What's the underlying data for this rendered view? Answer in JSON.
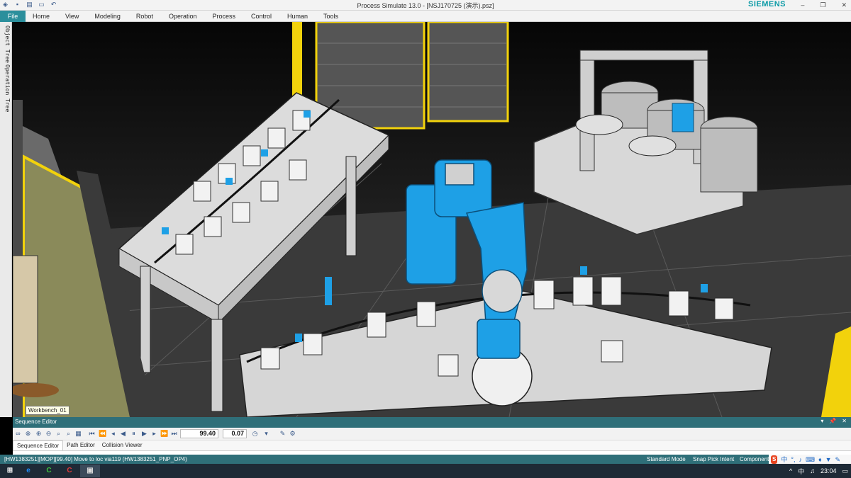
{
  "window": {
    "title": "Process Simulate 13.0 - [NSJ170725 (演示).psz]",
    "brand": "SIEMENS",
    "minimize_glyph": "–",
    "restore_glyph": "❐",
    "close_glyph": "✕"
  },
  "quick_access": {
    "icons": [
      "logo-icon",
      "save-icon",
      "open-icon",
      "new-icon",
      "undo-icon"
    ],
    "undo_glyph": "↶"
  },
  "menu": {
    "file": "File",
    "items": [
      "Home",
      "View",
      "Modeling",
      "Robot",
      "Operation",
      "Process",
      "Control",
      "Human",
      "Tools"
    ]
  },
  "left_dock": {
    "tabs": [
      "Object Tree",
      "Operation Tree"
    ]
  },
  "viewport": {
    "tooltip": "Workbench_01",
    "colors": {
      "robot": "#1ea0e6",
      "fence": "#f2d20c",
      "table": "#dcdcdc",
      "floor": "#3c3c3c"
    }
  },
  "sequence_editor": {
    "title": "Sequence Editor",
    "collapse_glyph": "▾",
    "pin_glyph": "📌",
    "close_glyph": "✕",
    "time_value": "99.40",
    "step_value": "0.07",
    "tabs": [
      "Sequence Editor",
      "Path Editor",
      "Collision Viewer"
    ]
  },
  "status_bar": {
    "message": "[HW1383251][MOP][99.40] Move to loc via119 (HW1383251_PNP_OP4)",
    "mode": "Standard Mode",
    "snap": "Snap Pick Intent",
    "component": "Component",
    "ime_label": "S"
  },
  "taskbar": {
    "start_glyph": "⊞",
    "buttons": [
      {
        "name": "ie-icon",
        "glyph": "e",
        "color": "#1e90ff"
      },
      {
        "name": "app-green-icon",
        "glyph": "C",
        "color": "#3ec43e"
      },
      {
        "name": "app-red-icon",
        "glyph": "C",
        "color": "#e33b3b"
      },
      {
        "name": "process-simulate-icon",
        "glyph": "▣",
        "color": "#d9d9d9"
      }
    ],
    "tray_chevron": "^",
    "tray_lang": "中",
    "clock": "23:04"
  }
}
